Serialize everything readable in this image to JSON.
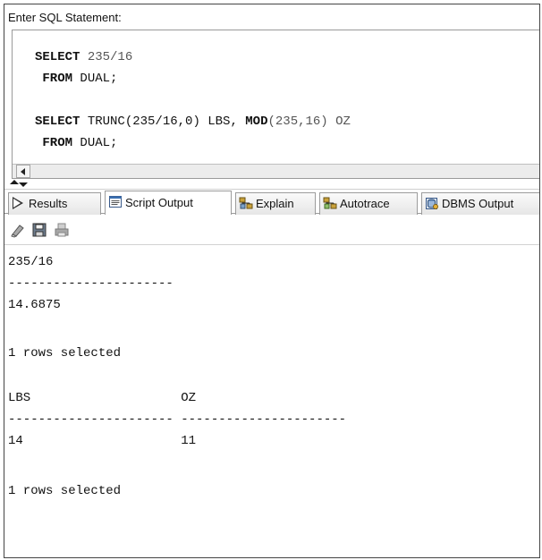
{
  "editor": {
    "prompt": "Enter SQL Statement:",
    "lines": [
      {
        "kw": "SELECT",
        "rest": " 235/16"
      },
      {
        "kw": " FROM",
        "rest": " DUAL;"
      },
      {
        "kw": "SELECT",
        "rest_a": " TRUNC(235/16,0) LBS, ",
        "kw2": "MOD",
        "rest_b": "(235,16) OZ"
      },
      {
        "kw": " FROM",
        "rest": " DUAL;"
      }
    ]
  },
  "tabs": [
    {
      "label": "Results",
      "icon": "play-outline-icon"
    },
    {
      "label": "Script Output",
      "icon": "script-icon"
    },
    {
      "label": "Explain",
      "icon": "explain-plan-icon"
    },
    {
      "label": "Autotrace",
      "icon": "autotrace-icon"
    },
    {
      "label": "DBMS Output",
      "icon": "dbms-output-icon"
    }
  ],
  "active_tab": "Script Output",
  "toolbar": {
    "icons": [
      "eraser-icon",
      "save-icon",
      "print-icon"
    ]
  },
  "output": {
    "lines": [
      "235/16",
      "----------------------",
      "14.6875",
      "",
      "1 rows selected",
      "",
      "LBS                    OZ",
      "---------------------- ----------------------",
      "14                     11",
      "",
      "1 rows selected"
    ]
  },
  "colors": {
    "border": "#9a9a9a",
    "tab_bg": "#e6e6e6",
    "text": "#111111"
  }
}
